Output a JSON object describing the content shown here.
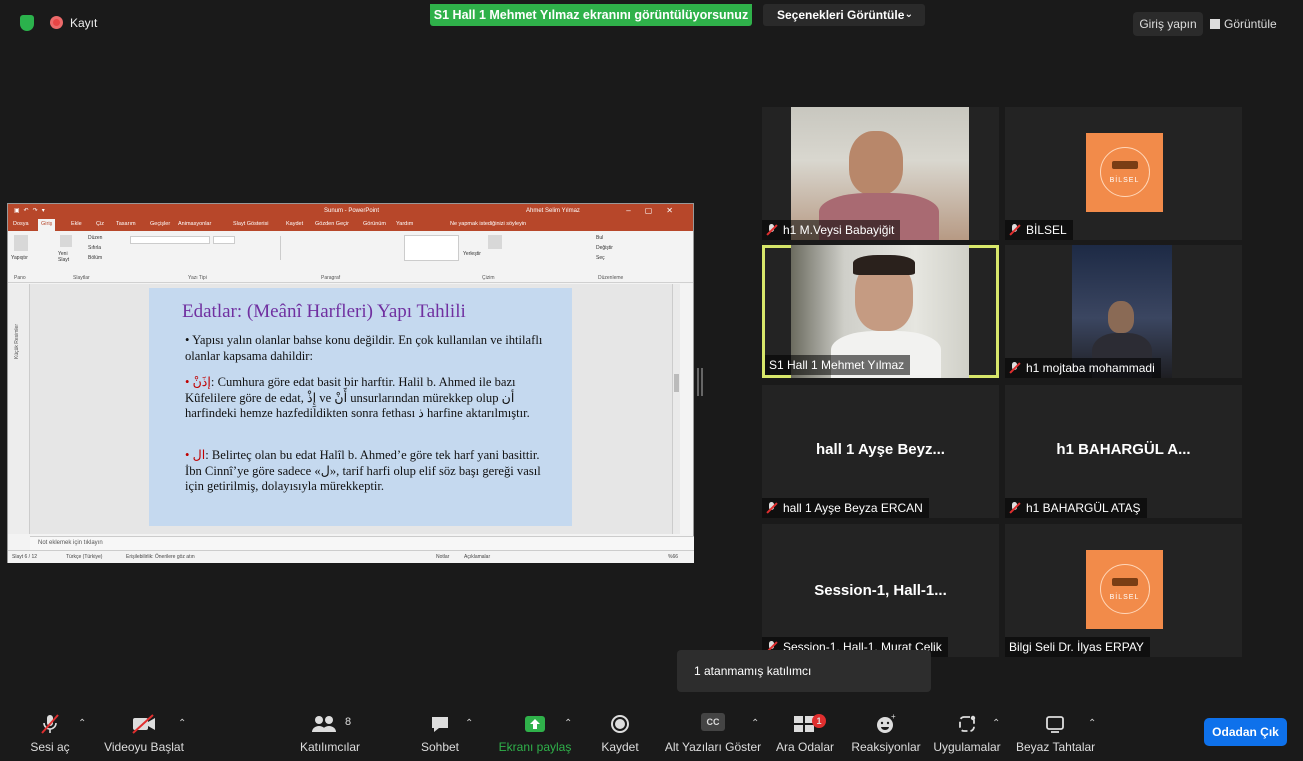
{
  "topbar": {
    "record_label": "Kayıt",
    "share_banner": "S1 Hall 1 Mehmet Yılmaz ekranını görüntülüyorsunuz",
    "options_label": "Seçenekleri Görüntüle",
    "login_label": "Giriş yapın",
    "view_label": "Görüntüle"
  },
  "ppt": {
    "window_title": "Sunum - PowerPoint",
    "user_name": "Ahmet Selim Yılmaz",
    "tabs": [
      "Dosya",
      "Giriş",
      "Ekle",
      "Çiz",
      "Tasarım",
      "Geçişler",
      "Animasyonlar",
      "Slayt Gösterisi",
      "Kaydet",
      "Gözden Geçir",
      "Görünüm",
      "Yardım",
      "Ne yapmak istediğinizi söyleyin"
    ],
    "ribbon_groups": [
      "Pano",
      "Slaytlar",
      "Yazı Tipi",
      "Paragraf",
      "Çizim",
      "Düzenleme"
    ],
    "ribbon_items": {
      "paste": "Yapıştır",
      "new_slide": "Yeni Slayt",
      "layout": "Düzen",
      "reset": "Sıfırla",
      "section": "Bölüm",
      "arrange": "Yerleştir",
      "find": "Bul",
      "replace": "Değiştir",
      "select": "Seç"
    },
    "thumb_pane_label": "Küçük Resimler",
    "slide": {
      "title": "Edatlar: (Meânî Harfleri) Yapı Tahlili",
      "b1": "• Yapısı yalın olanlar bahse konu değildir. En çok kullanılan ve ihtilaflı olanlar kapsama dahildir:",
      "b2_arabic": "إذَنْ",
      "b2_text": ": Cumhura göre edat basit bir harftir. Halil b. Ahmed ile bazı Kûfelilere göre de edat, إِذْ ve أَنْ unsurlarından mürekkep olup أن harfindeki hemze hazfedildikten sonra fethası ذ harfine aktarılmıştır.",
      "b3_arabic": "ال",
      "b3_text": ": Belirteç olan bu edat Halîl b. Ahmed’e göre tek harf yani basittir. İbn Cinnî’ye göre sadece «ل», tarif harfi olup elif söz başı gereği vasıl için getirilmiş, dolayısıyla mürekkeptir."
    },
    "notes_placeholder": "Not eklemek için tıklayın",
    "status": {
      "slide": "Slayt 6 / 12",
      "lang": "Türkçe (Türkiye)",
      "access": "Erişilebilirlik: Önerilere göz atın",
      "notes": "Notlar",
      "comments": "Açıklamalar",
      "zoom": "%66"
    }
  },
  "participants": [
    {
      "label": "h1 M.Veysi Babayiğit",
      "type": "video"
    },
    {
      "label": "BİLSEL",
      "type": "logo",
      "logo_text": "BİLSEL"
    },
    {
      "label": "S1 Hall 1 Mehmet Yılmaz",
      "type": "video",
      "active": true
    },
    {
      "label": "h1 mojtaba mohammadi",
      "type": "video"
    },
    {
      "label": "hall 1 Ayşe Beyza ERCAN",
      "big": "hall 1 Ayşe Beyz...",
      "type": "name"
    },
    {
      "label": "h1 BAHARGÜL ATAŞ",
      "big": "h1 BAHARGÜL A...",
      "type": "name"
    },
    {
      "label": "Session-1, Hall-1, Murat Çelik",
      "big": "Session-1,  Hall-1...",
      "type": "name"
    },
    {
      "label": "Bilgi Seli Dr. İlyas ERPAY",
      "type": "logo",
      "logo_text": "BİLSEL"
    }
  ],
  "tooltip": "1 atanmamış katılımcı",
  "toolbar": {
    "unmute": "Sesi aç",
    "start_video": "Videoyu Başlat",
    "participants": "Katılımcılar",
    "participant_count": "8",
    "chat": "Sohbet",
    "share": "Ekranı paylaş",
    "record": "Kaydet",
    "captions": "Alt Yazıları Göster",
    "captions_icon_text": "CC",
    "breakout": "Ara Odalar",
    "breakout_badge": "1",
    "reactions": "Reaksiyonlar",
    "apps": "Uygulamalar",
    "whiteboards": "Beyaz Tahtalar",
    "leave_room": "Odadan Çık"
  },
  "colors": {
    "share_green": "#2fb14a",
    "active_outline": "#d7e66a",
    "leave_blue": "#0e71eb",
    "ppt_red": "#b7472a",
    "slide_bg": "#c5d9ef",
    "title_purple": "#7030a0"
  }
}
